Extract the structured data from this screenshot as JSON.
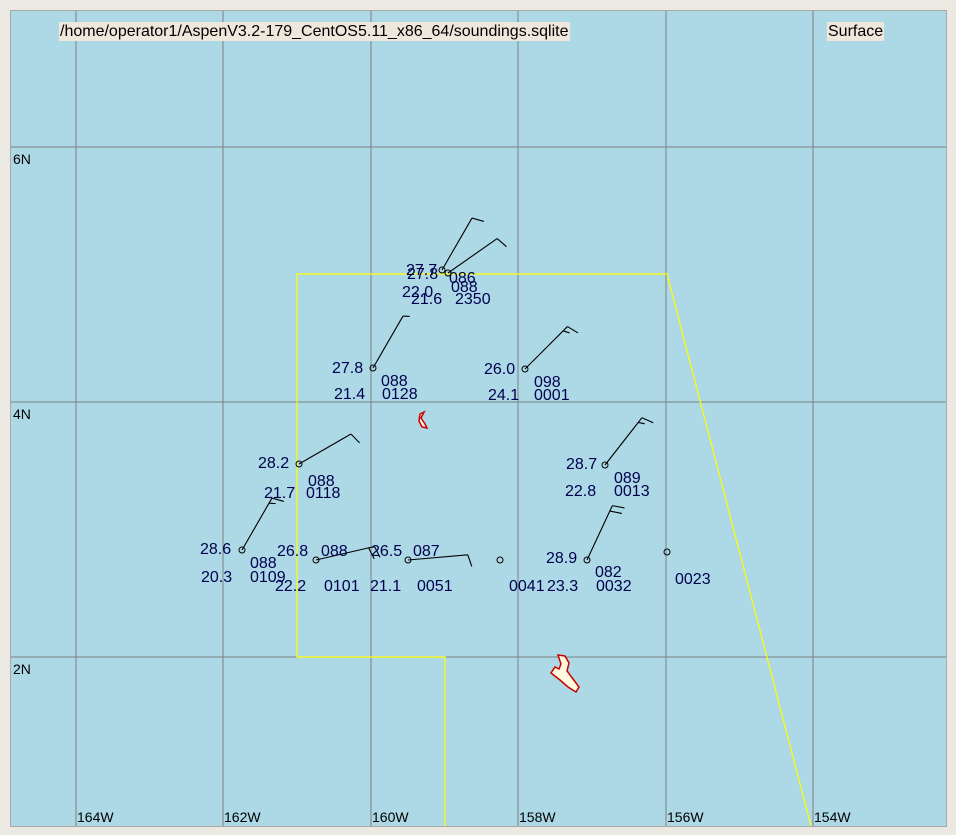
{
  "header": {
    "file_path": "/home/operator1/AspenV3.2-179_CentOS5.11_x86_64/soundings.sqlite",
    "level": "Surface"
  },
  "axes": {
    "longitude_labels": [
      "164W",
      "162W",
      "160W",
      "158W",
      "156W",
      "154W"
    ],
    "latitude_labels": [
      "6N",
      "4N",
      "2N"
    ]
  },
  "colors": {
    "ocean": "#add8e6",
    "grid": "#808080",
    "boundary": "#ffff00",
    "island_outline": "#cc0000",
    "island_fill": "#fffbe0",
    "station_text": "#00004e",
    "barb": "#000000"
  },
  "stations": [
    {
      "id": "s1",
      "temp": "27.7",
      "dew": "22.0",
      "wind_dir": "086",
      "time": "",
      "wind_from_deg": 30,
      "barbs": [
        10
      ]
    },
    {
      "id": "s2",
      "temp": "27.8",
      "dew": "21.6",
      "wind_dir": "088",
      "time": "2350",
      "wind_from_deg": 55,
      "barbs": [
        10
      ]
    },
    {
      "id": "s3",
      "temp": "27.8",
      "dew": "21.4",
      "wind_dir": "088",
      "time": "0128",
      "wind_from_deg": 30,
      "barbs": [
        5
      ]
    },
    {
      "id": "s4",
      "temp": "26.0",
      "dew": "24.1",
      "wind_dir": "098",
      "time": "0001",
      "wind_from_deg": 45,
      "barbs": [
        10,
        5
      ]
    },
    {
      "id": "s5",
      "temp": "28.2",
      "dew": "21.7",
      "wind_dir": "088",
      "time": "0118",
      "wind_from_deg": 60,
      "barbs": [
        10
      ]
    },
    {
      "id": "s6",
      "temp": "28.7",
      "dew": "22.8",
      "wind_dir": "089",
      "time": "0013",
      "wind_from_deg": 38,
      "barbs": [
        10,
        5
      ]
    },
    {
      "id": "s7",
      "temp": "28.6",
      "dew": "20.3",
      "wind_dir": "088",
      "time": "0109",
      "wind_from_deg": 30,
      "barbs": [
        10,
        5
      ]
    },
    {
      "id": "s8",
      "temp": "26.8",
      "dew": "22.2",
      "wind_dir": "088",
      "time": "0101",
      "wind_from_deg": 77,
      "barbs": [
        10,
        10
      ]
    },
    {
      "id": "s9",
      "temp": "26.5",
      "dew": "21.1",
      "wind_dir": "087",
      "time": "0051",
      "wind_from_deg": 85,
      "barbs": [
        10
      ]
    },
    {
      "id": "s10",
      "temp": "",
      "dew": "",
      "wind_dir": "",
      "time": "0041",
      "wind_from_deg": null,
      "barbs": []
    },
    {
      "id": "s11",
      "temp": "28.9",
      "dew": "23.3",
      "wind_dir": "082",
      "time": "0032",
      "wind_from_deg": 25,
      "barbs": [
        10,
        10
      ]
    },
    {
      "id": "s12",
      "temp": "",
      "dew": "",
      "wind_dir": "",
      "time": "0023",
      "wind_from_deg": null,
      "barbs": []
    }
  ]
}
